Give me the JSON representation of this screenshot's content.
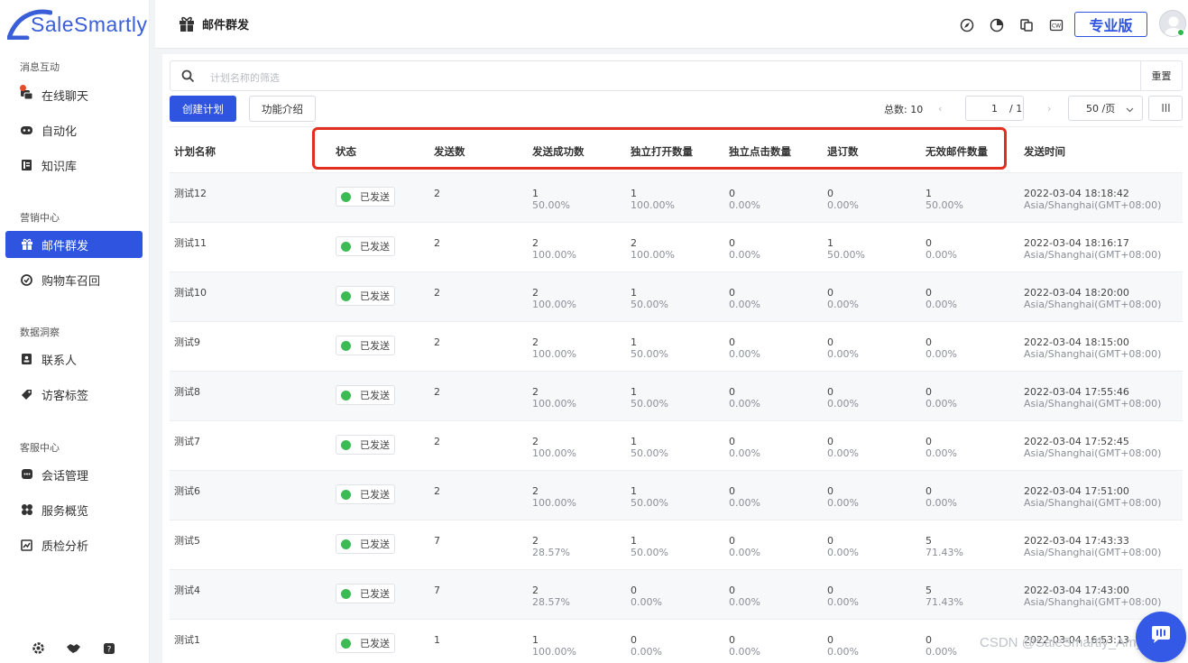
{
  "brand": {
    "name": "SaleSmartly",
    "color": "#2e54e0"
  },
  "sidebar": {
    "sections": [
      {
        "title": "消息互动",
        "items": [
          {
            "label": "在线聊天",
            "icon": "chat-icon"
          },
          {
            "label": "自动化",
            "icon": "robot-icon"
          },
          {
            "label": "知识库",
            "icon": "book-icon"
          }
        ]
      },
      {
        "title": "营销中心",
        "items": [
          {
            "label": "邮件群发",
            "icon": "gift-icon",
            "active": true
          },
          {
            "label": "购物车召回",
            "icon": "recall-icon"
          }
        ]
      },
      {
        "title": "数据洞察",
        "items": [
          {
            "label": "联系人",
            "icon": "contact-icon"
          },
          {
            "label": "访客标签",
            "icon": "tag-icon"
          }
        ]
      },
      {
        "title": "客服中心",
        "items": [
          {
            "label": "会话管理",
            "icon": "conversation-icon"
          },
          {
            "label": "服务概览",
            "icon": "overview-icon"
          },
          {
            "label": "质检分析",
            "icon": "chart-icon"
          }
        ]
      }
    ],
    "bottom_icons": [
      "settings-icon",
      "handshake-icon",
      "help-icon"
    ]
  },
  "header": {
    "title": "邮件群发",
    "pro_label": "专业版",
    "icons": [
      "compass-icon",
      "pie-icon",
      "copy-icon",
      "cw-icon"
    ]
  },
  "search": {
    "placeholder": "计划名称的筛选",
    "reset_label": "重置"
  },
  "toolbar": {
    "create_label": "创建计划",
    "intro_label": "功能介绍",
    "total_label": "总数: 10",
    "page_current": "1",
    "page_total": "/ 1",
    "page_size": "50 /页",
    "prev": "‹",
    "next": "›",
    "columns_icon": "|||"
  },
  "table": {
    "columns": [
      "计划名称",
      "状态",
      "发送数",
      "发送成功数",
      "独立打开数量",
      "独立点击数量",
      "退订数",
      "无效邮件数量",
      "发送时间"
    ],
    "rows": [
      {
        "name": "测试12",
        "status": "已发送",
        "sent": "2",
        "success": [
          "1",
          "50.00%"
        ],
        "open": [
          "1",
          "100.00%"
        ],
        "click": [
          "0",
          "0.00%"
        ],
        "unsub": [
          "0",
          "0.00%"
        ],
        "invalid": [
          "1",
          "50.00%"
        ],
        "time": [
          "2022-03-04 18:18:42",
          "Asia/Shanghai(GMT+08:00)"
        ]
      },
      {
        "name": "测试11",
        "status": "已发送",
        "sent": "2",
        "success": [
          "2",
          "100.00%"
        ],
        "open": [
          "2",
          "100.00%"
        ],
        "click": [
          "0",
          "0.00%"
        ],
        "unsub": [
          "1",
          "50.00%"
        ],
        "invalid": [
          "0",
          "0.00%"
        ],
        "time": [
          "2022-03-04 18:16:17",
          "Asia/Shanghai(GMT+08:00)"
        ]
      },
      {
        "name": "测试10",
        "status": "已发送",
        "sent": "2",
        "success": [
          "2",
          "100.00%"
        ],
        "open": [
          "1",
          "50.00%"
        ],
        "click": [
          "0",
          "0.00%"
        ],
        "unsub": [
          "0",
          "0.00%"
        ],
        "invalid": [
          "0",
          "0.00%"
        ],
        "time": [
          "2022-03-04 18:20:00",
          "Asia/Shanghai(GMT+08:00)"
        ]
      },
      {
        "name": "测试9",
        "status": "已发送",
        "sent": "2",
        "success": [
          "2",
          "100.00%"
        ],
        "open": [
          "1",
          "50.00%"
        ],
        "click": [
          "0",
          "0.00%"
        ],
        "unsub": [
          "0",
          "0.00%"
        ],
        "invalid": [
          "0",
          "0.00%"
        ],
        "time": [
          "2022-03-04 18:15:00",
          "Asia/Shanghai(GMT+08:00)"
        ]
      },
      {
        "name": "测试8",
        "status": "已发送",
        "sent": "2",
        "success": [
          "2",
          "100.00%"
        ],
        "open": [
          "1",
          "50.00%"
        ],
        "click": [
          "0",
          "0.00%"
        ],
        "unsub": [
          "0",
          "0.00%"
        ],
        "invalid": [
          "0",
          "0.00%"
        ],
        "time": [
          "2022-03-04 17:55:46",
          "Asia/Shanghai(GMT+08:00)"
        ]
      },
      {
        "name": "测试7",
        "status": "已发送",
        "sent": "2",
        "success": [
          "2",
          "100.00%"
        ],
        "open": [
          "1",
          "50.00%"
        ],
        "click": [
          "0",
          "0.00%"
        ],
        "unsub": [
          "0",
          "0.00%"
        ],
        "invalid": [
          "0",
          "0.00%"
        ],
        "time": [
          "2022-03-04 17:52:45",
          "Asia/Shanghai(GMT+08:00)"
        ]
      },
      {
        "name": "测试6",
        "status": "已发送",
        "sent": "2",
        "success": [
          "2",
          "100.00%"
        ],
        "open": [
          "1",
          "50.00%"
        ],
        "click": [
          "0",
          "0.00%"
        ],
        "unsub": [
          "0",
          "0.00%"
        ],
        "invalid": [
          "0",
          "0.00%"
        ],
        "time": [
          "2022-03-04 17:51:00",
          "Asia/Shanghai(GMT+08:00)"
        ]
      },
      {
        "name": "测试5",
        "status": "已发送",
        "sent": "7",
        "success": [
          "2",
          "28.57%"
        ],
        "open": [
          "1",
          "50.00%"
        ],
        "click": [
          "0",
          "0.00%"
        ],
        "unsub": [
          "0",
          "0.00%"
        ],
        "invalid": [
          "5",
          "71.43%"
        ],
        "time": [
          "2022-03-04 17:43:33",
          "Asia/Shanghai(GMT+08:00)"
        ]
      },
      {
        "name": "测试4",
        "status": "已发送",
        "sent": "7",
        "success": [
          "2",
          "28.57%"
        ],
        "open": [
          "0",
          "0.00%"
        ],
        "click": [
          "0",
          "0.00%"
        ],
        "unsub": [
          "0",
          "0.00%"
        ],
        "invalid": [
          "5",
          "71.43%"
        ],
        "time": [
          "2022-03-04 17:43:00",
          "Asia/Shanghai(GMT+08:00)"
        ]
      },
      {
        "name": "测试1",
        "status": "已发送",
        "sent": "1",
        "success": [
          "1",
          "100.00%"
        ],
        "open": [
          "0",
          "0.00%"
        ],
        "click": [
          "0",
          "0.00%"
        ],
        "unsub": [
          "0",
          "0.00%"
        ],
        "invalid": [
          "0",
          "0.00%"
        ],
        "time": [
          "2022-03-04 16:53:13",
          ""
        ]
      }
    ]
  },
  "watermark": "CSDN @SaleSmartly_Amy",
  "colors": {
    "accent": "#2e54e0",
    "status_green": "#3cba54",
    "highlight": "#e12e1e"
  }
}
